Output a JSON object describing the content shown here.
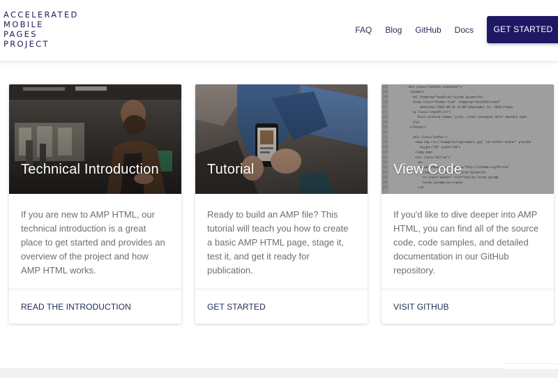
{
  "logo": {
    "lines": [
      "Accelerated",
      "Mobile",
      "Pages",
      "Project"
    ]
  },
  "nav": {
    "items": [
      "FAQ",
      "Blog",
      "GitHub",
      "Docs"
    ]
  },
  "cta": {
    "label": "GET STARTED"
  },
  "cards": [
    {
      "title": "Technical Introduction",
      "body": "If you are new to AMP HTML, our technical introduction is a great place to get started and provides an overview of the project and how AMP HTML works.",
      "link": "READ THE INTRODUCTION"
    },
    {
      "title": "Tutorial",
      "body": "Ready to build an AMP file? This tutorial will teach you how to create a basic AMP HTML page, stage it, test it, and get it ready for publication.",
      "link": "GET STARTED"
    },
    {
      "title": "View Code",
      "body": "If you'd like to dive deeper into AMP HTML, you can find all of the source code, code samples, and detailed documentation in our GitHub repository.",
      "link": "VISIT GITHUB"
    }
  ],
  "code_lines": [
    "<div class=\"content-container\">",
    "<header>",
    "<h1 itemprop=\"headline\">Lorem Ipsum</h1>",
    "<time class=\"header-time\" itemprop=\"datePublished\"",
    "datetime=\"2015-09-14 13:00\">September 14, 2015</time>",
    "<p class=\"standfirst\">",
    "Fusce pretium tempor justo, vitae consequat dolor maximus eget.",
    "</p>",
    "</header>",
    "",
    "<div class=\"author\">",
    "<amp-img src=\"/examples/img/sample.jpg\" id=\"author-avatar\" placeho",
    "height=\"50\" width=\"50\">",
    "</amp-img>",
    "<div class=\"byline\">",
    "<p>",
    "<span itemscope itemtype=\"http://schema.org/Person\"",
    "itemprop=\"author\"><b>Lorem Ipsum</b>",
    "<a class=\"author\" href=\"mailto:lorem.ipsum@",
    "lorem.ipsum@</a></span>",
    "</p>"
  ],
  "colors": {
    "brand": "#1f1865",
    "nav_text": "#2a2a5a",
    "body_text": "#6e6e6e",
    "link_text": "#1e2a52"
  }
}
